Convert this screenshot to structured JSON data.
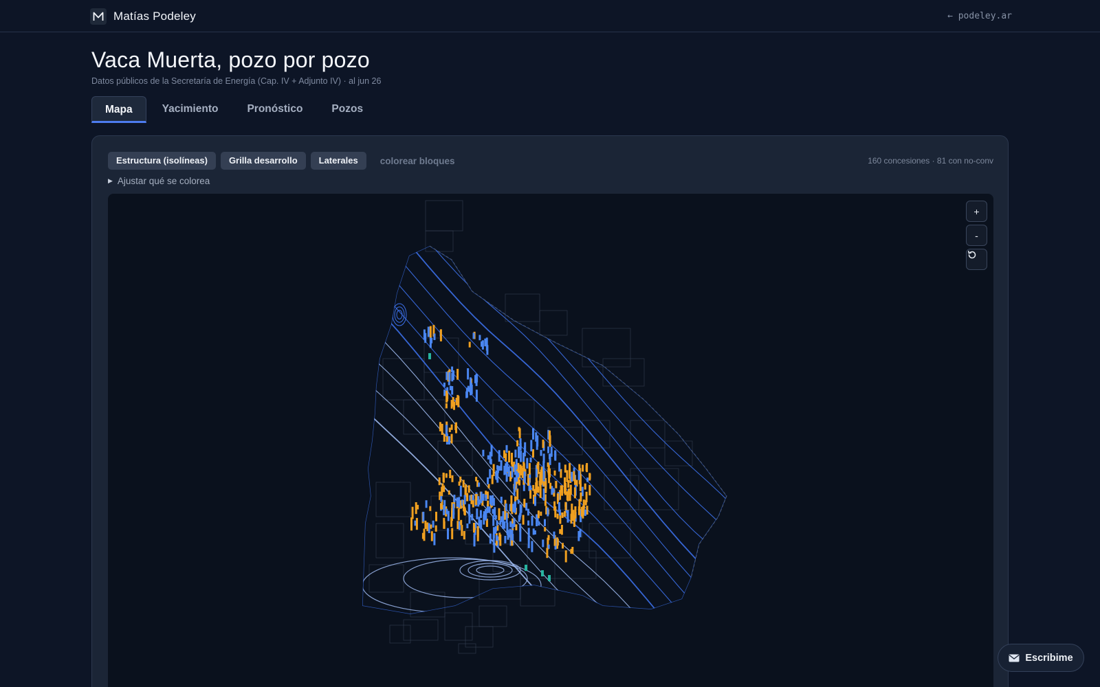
{
  "header": {
    "brand_name": "Matías Podeley",
    "logo_letter": "M",
    "back_link": "← podeley.ar"
  },
  "page": {
    "title": "Vaca Muerta, pozo por pozo",
    "subtitle": "Datos públicos de la Secretaría de Energía (Cap. IV + Adjunto IV) · al jun 26"
  },
  "tabs": [
    {
      "label": "Mapa",
      "active": true
    },
    {
      "label": "Yacimiento",
      "active": false
    },
    {
      "label": "Pronóstico",
      "active": false
    },
    {
      "label": "Pozos",
      "active": false
    }
  ],
  "toolbar": {
    "chips": [
      {
        "label": "Estructura (isolíneas)"
      },
      {
        "label": "Grilla desarrollo"
      },
      {
        "label": "Laterales"
      }
    ],
    "ghost_label": "colorear bloques",
    "count_label": "160 concesiones · 81 con no-conv",
    "adjust_label": "Ajustar qué se colorea"
  },
  "map_controls": {
    "zoom_in": "+",
    "zoom_out": "-",
    "reset_icon": "reset-icon"
  },
  "map": {
    "colors": {
      "background": "#0a111d",
      "isoline": "#3b6fe8",
      "isoline_light": "#9fbaf0",
      "concession_border": "#3a4458",
      "wells_gas": "#f0a020",
      "wells_oil": "#4a86f0",
      "wells_other": "#27b4a0"
    }
  },
  "contact": {
    "label": "Escribime",
    "icon": "mail-icon"
  }
}
